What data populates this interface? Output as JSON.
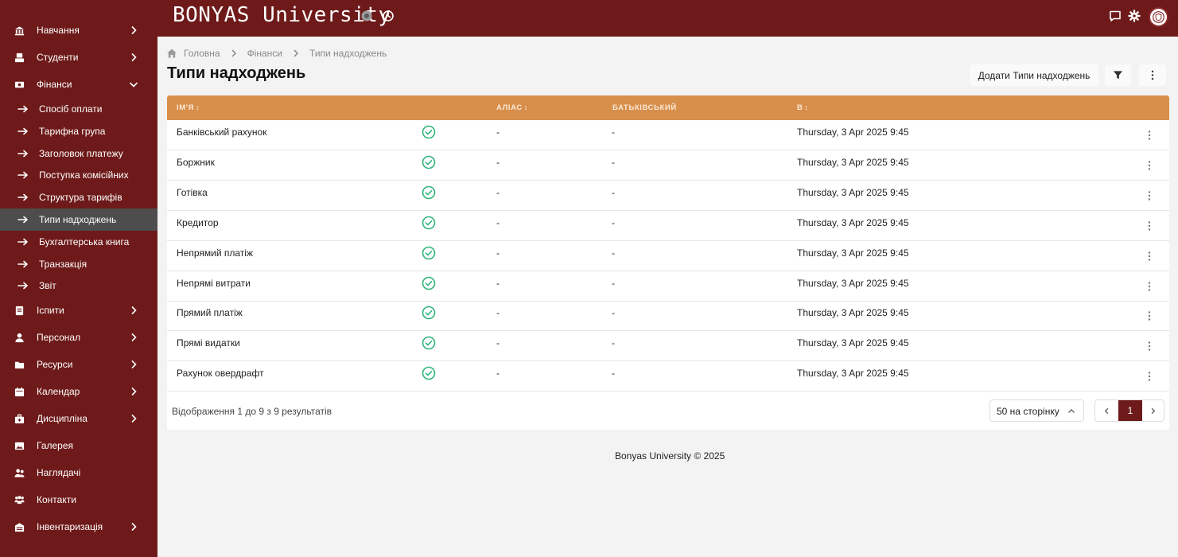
{
  "app": {
    "brand": "BONYAS University"
  },
  "colors": {
    "primary": "#6e1a1a",
    "table_header": "#d88f4b",
    "active_sidebar": "#4d4d4d",
    "check_green": "#2fb57a"
  },
  "sidebar": {
    "items": [
      {
        "label": "Навчання",
        "icon": "building-icon",
        "chevron": "right"
      },
      {
        "label": "Студенти",
        "icon": "student-icon",
        "chevron": "right"
      },
      {
        "label": "Фінанси",
        "icon": "money-icon",
        "chevron": "down"
      }
    ],
    "finance_subitems": [
      {
        "label": "Спосіб оплати"
      },
      {
        "label": "Тарифна група"
      },
      {
        "label": "Заголовок платежу"
      },
      {
        "label": "Поступка комісійних"
      },
      {
        "label": "Структура тарифів"
      },
      {
        "label": "Типи надходжень",
        "active": true
      },
      {
        "label": "Бухгалтерська книга"
      },
      {
        "label": "Транзакція"
      },
      {
        "label": "Звіт"
      }
    ],
    "items_after": [
      {
        "label": "Іспити",
        "icon": "exam-icon",
        "chevron": "right"
      },
      {
        "label": "Персонал",
        "icon": "person-icon",
        "chevron": "right"
      },
      {
        "label": "Ресурси",
        "icon": "folder-icon",
        "chevron": "right"
      },
      {
        "label": "Календар",
        "icon": "calendar-icon",
        "chevron": "right"
      },
      {
        "label": "Дисципліна",
        "icon": "discipline-icon",
        "chevron": "right"
      },
      {
        "label": "Галерея",
        "icon": "gallery-icon",
        "chevron": ""
      },
      {
        "label": "Наглядачі",
        "icon": "guardians-icon",
        "chevron": ""
      },
      {
        "label": "Контакти",
        "icon": "contacts-icon",
        "chevron": ""
      },
      {
        "label": "Інвентаризація",
        "icon": "inventory-icon",
        "chevron": "right"
      }
    ]
  },
  "breadcrumb": {
    "home": "Головна",
    "section": "Фінанси",
    "current": "Типи надходжень"
  },
  "page": {
    "title": "Типи надходжень",
    "add_button": "Додати Типи надходжень"
  },
  "table": {
    "headers": {
      "name": "ІМ'Я",
      "alias": "АЛІАС",
      "parent": "БАТЬКІВСЬКИЙ",
      "date": "В"
    },
    "rows": [
      {
        "name": "Банківський рахунок",
        "alias": "-",
        "parent": "-",
        "date": "Thursday, 3 Apr 2025 9:45"
      },
      {
        "name": "Боржник",
        "alias": "-",
        "parent": "-",
        "date": "Thursday, 3 Apr 2025 9:45"
      },
      {
        "name": "Готівка",
        "alias": "-",
        "parent": "-",
        "date": "Thursday, 3 Apr 2025 9:45"
      },
      {
        "name": "Кредитор",
        "alias": "-",
        "parent": "-",
        "date": "Thursday, 3 Apr 2025 9:45"
      },
      {
        "name": "Непрямий платіж",
        "alias": "-",
        "parent": "-",
        "date": "Thursday, 3 Apr 2025 9:45"
      },
      {
        "name": "Непрямі витрати",
        "alias": "-",
        "parent": "-",
        "date": "Thursday, 3 Apr 2025 9:45"
      },
      {
        "name": "Прямий платіж",
        "alias": "-",
        "parent": "-",
        "date": "Thursday, 3 Apr 2025 9:45"
      },
      {
        "name": "Прямі видатки",
        "alias": "-",
        "parent": "-",
        "date": "Thursday, 3 Apr 2025 9:45"
      },
      {
        "name": "Рахунок овердрафт",
        "alias": "-",
        "parent": "-",
        "date": "Thursday, 3 Apr 2025 9:45"
      }
    ],
    "results_text": "Відображення 1 до 9 з 9 результатів",
    "per_page": "50 на сторінку",
    "current_page": "1"
  },
  "footer": {
    "copyright": "Bonyas University © 2025"
  }
}
